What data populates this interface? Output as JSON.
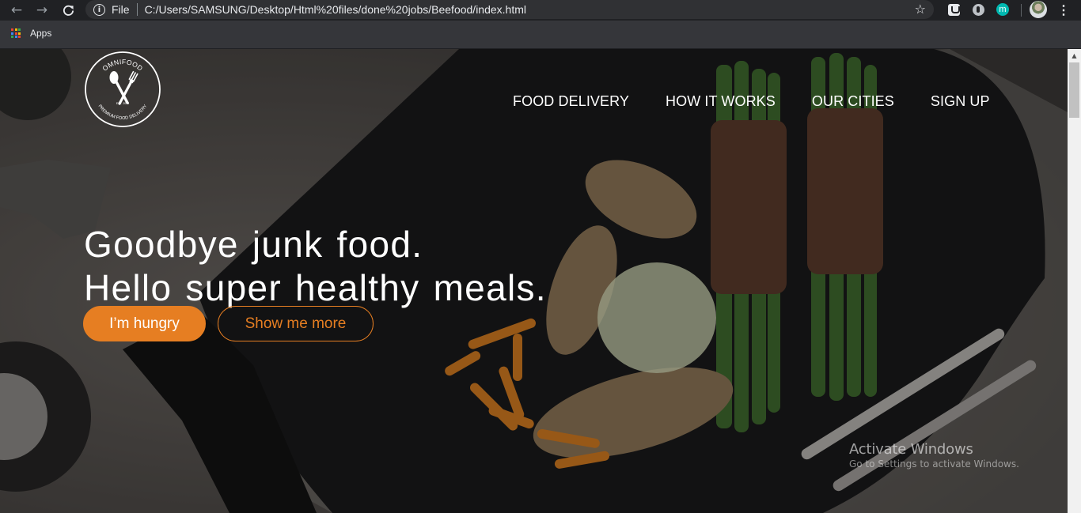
{
  "browser": {
    "back_icon": "arrow-left-icon",
    "forward_icon": "arrow-right-icon",
    "reload_icon": "reload-icon",
    "scheme_label": "File",
    "url": "C:/Users/SAMSUNG/Desktop/Html%20files/done%20jobs/Beefood/index.html",
    "extension_m_label": "m",
    "bookmarks": {
      "apps_label": "Apps"
    }
  },
  "site": {
    "logo": {
      "top_text": "OMNIFOOD",
      "bottom_text": "PREMIUM FOOD DELIVERY",
      "est_text": "EST. 2014"
    },
    "nav": [
      {
        "label": "FOOD DELIVERY"
      },
      {
        "label": "HOW IT WORKS"
      },
      {
        "label": "OUR CITIES"
      },
      {
        "label": "SIGN UP"
      }
    ],
    "hero": {
      "line1": "Goodbye junk food.",
      "line2": "Hello super healthy meals.",
      "primary_button": "I’m hungry",
      "secondary_button": "Show me more"
    }
  },
  "os_overlay": {
    "activate_title": "Activate Windows",
    "activate_subtitle": "Go to Settings to activate Windows."
  },
  "colors": {
    "accent": "#e67e22",
    "browser_dark": "#202124",
    "browser_mid": "#35363a"
  }
}
